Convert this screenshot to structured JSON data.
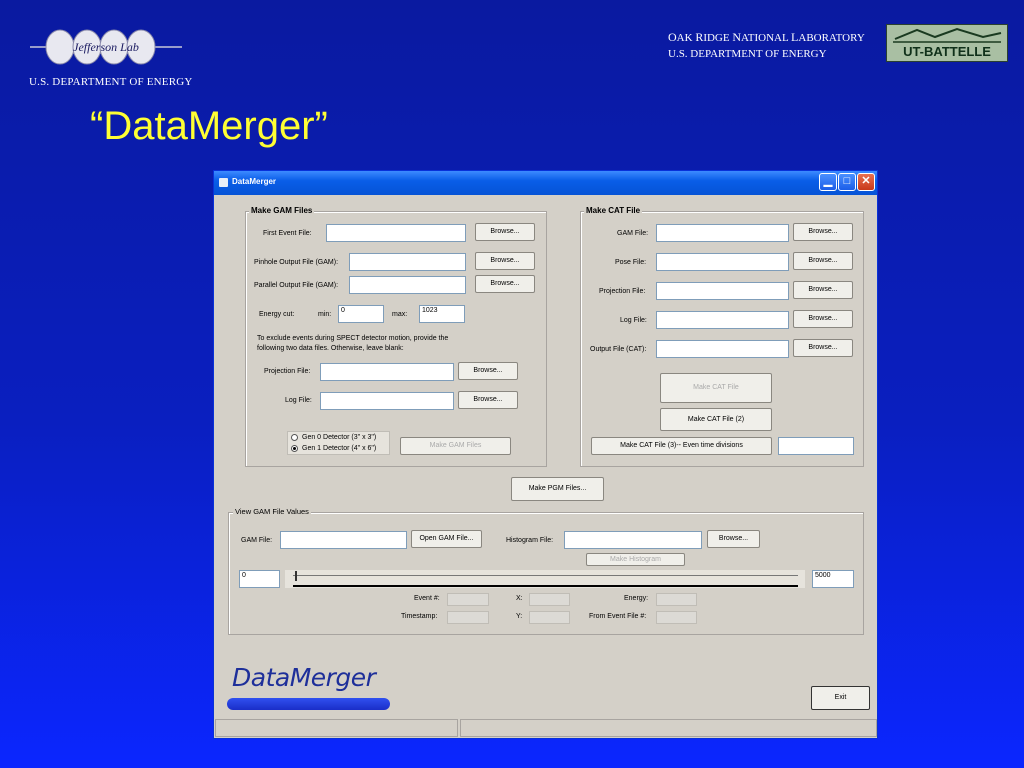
{
  "slide": {
    "jlab_logo_text": "Jefferson Lab",
    "doe_left": "U.S. DEPARTMENT OF ENERGY",
    "ornl_line1": {
      "o": "O",
      "ak": "AK ",
      "r": "R",
      "idge": "IDGE ",
      "n": "N",
      "ational": "ATIONAL ",
      "l": "L",
      "aboratory": "ABORATORY"
    },
    "ornl_line2": "U.S. DEPARTMENT OF ENERGY",
    "utb_logo_text": "UT-BATTELLE",
    "title": "“DataMerger”"
  },
  "window": {
    "title": "DataMerger",
    "min_glyph": "▁",
    "max_glyph": "□",
    "close_glyph": "✕",
    "gam": {
      "group_label": "Make GAM Files",
      "first_event_label": "First Event File:",
      "pinhole_label": "Pinhole Output File (GAM):",
      "parallel_label": "Parallel Output File (GAM):",
      "energy_cut_label": "Energy cut:",
      "min_label": "min:",
      "max_label": "max:",
      "min_value": "0",
      "max_value": "1023",
      "note": "To exclude events during SPECT detector motion, provide the following two data files. Otherwise, leave blank:",
      "projection_label": "Projection File:",
      "log_label": "Log File:",
      "radio_gen0": "Gen 0 Detector (3\" x 3\")",
      "radio_gen1": "Gen 1 Detector (4\" x 6\")",
      "make_gam": "Make GAM Files"
    },
    "cat": {
      "group_label": "Make CAT File",
      "gam_label": "GAM File:",
      "pose_label": "Pose File:",
      "projection_label": "Projection File:",
      "log_label": "Log File:",
      "output_label": "Output File (CAT):",
      "make_cat": "Make CAT File",
      "make_cat2": "Make CAT File (2)",
      "make_cat3": "Make CAT File (3)-- Even time divisions"
    },
    "browse": "Browse...",
    "make_pgm": "Make PGM Files...",
    "view": {
      "group_label": "View GAM File Values",
      "gam_label": "GAM File:",
      "open_gam": "Open GAM File...",
      "histogram_label": "Histogram File:",
      "make_histogram": "Make Histogram",
      "slider_min": "0",
      "slider_max": "5000",
      "event_label": "Event #:",
      "x_label": "X:",
      "energy_label": "Energy:",
      "timestamp_label": "Timestamp:",
      "y_label": "Y:",
      "from_event_label": "From Event File #:"
    },
    "logo_text": "DataMerger",
    "exit": "Exit"
  }
}
